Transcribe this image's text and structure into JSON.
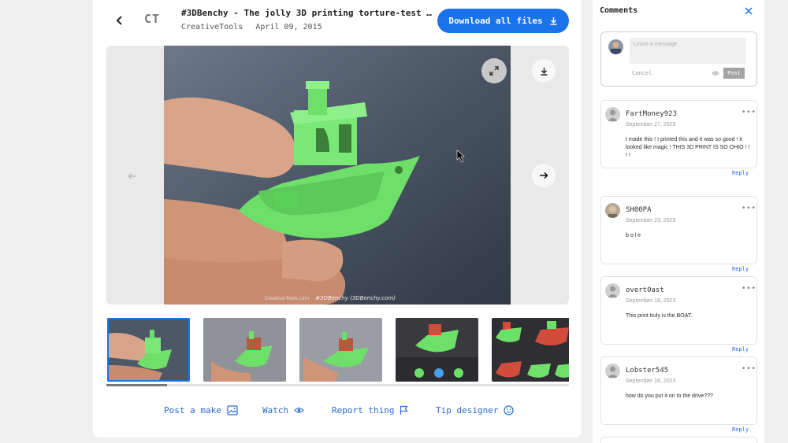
{
  "thing": {
    "title": "#3DBenchy - The jolly 3D printing torture-test …",
    "author": "CreativeTools",
    "date": "April 09, 2015",
    "logo_text": "CT",
    "download_label": "Download all files"
  },
  "viewer": {
    "caption": "#3DBenchy (3DBenchy.com)",
    "watermark": "Creative-Tools.com",
    "thumbnail_count": 5,
    "active_thumbnail": 0
  },
  "actions": [
    {
      "label": "Post a make",
      "icon": "image-icon"
    },
    {
      "label": "Watch",
      "icon": "eye-icon"
    },
    {
      "label": "Report thing",
      "icon": "flag-icon"
    },
    {
      "label": "Tip designer",
      "icon": "smiley-icon"
    }
  ],
  "comments_panel": {
    "title": "Comments",
    "compose": {
      "placeholder": "Leave a message",
      "cancel_label": "Cancel",
      "post_label": "Post"
    },
    "comments": [
      {
        "user": "FartMoney923",
        "date": "September 27, 2023",
        "text": "I made this ! I printed this and it was so good ! it looked like magic ! THIS 3D PRINT IS SO OHIO ! ! ! !",
        "reply_label": "Reply"
      },
      {
        "user": "SH00PA",
        "date": "September 23, 2023",
        "text": "b o l e",
        "reply_label": "Reply"
      },
      {
        "user": "overt0ast",
        "date": "September 18, 2023",
        "text": "This print truly is the BOAT.",
        "reply_label": "Reply"
      },
      {
        "user": "Lobster545",
        "date": "September 16, 2023",
        "text": "how do you put it on to the drive???",
        "reply_label": "Reply"
      }
    ]
  },
  "colors": {
    "accent": "#1a73e8",
    "link": "#2a6bd6",
    "benchy_green": "#6ee06a"
  }
}
